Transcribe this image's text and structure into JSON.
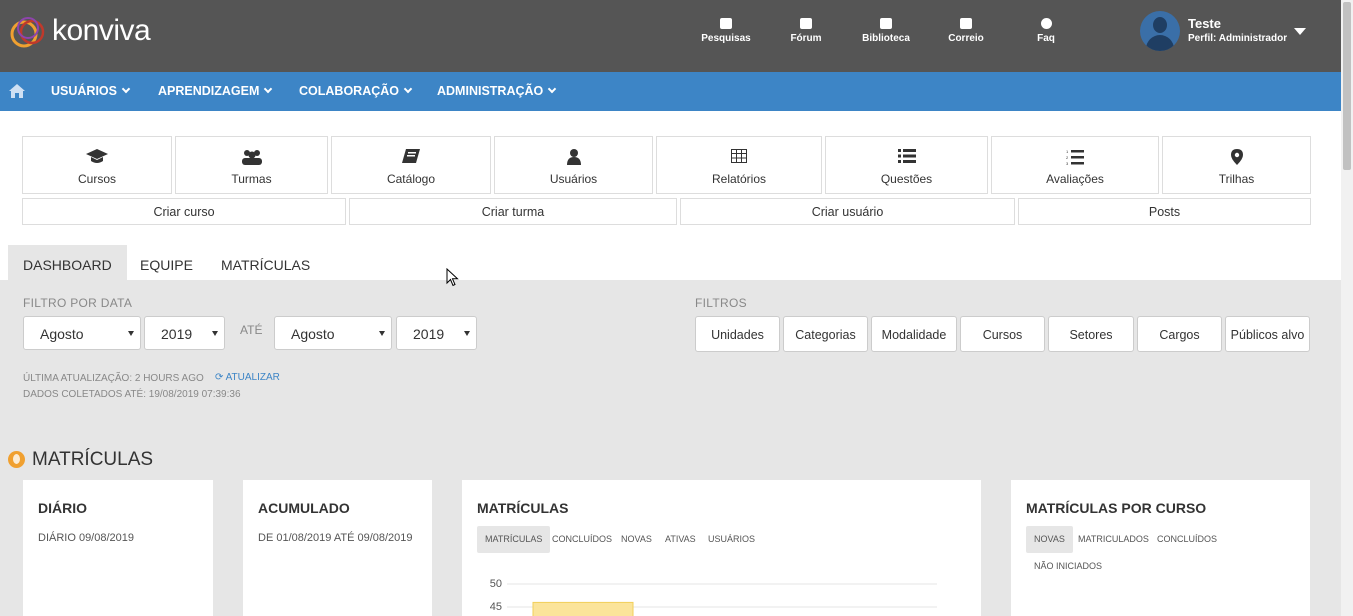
{
  "header": {
    "logo_text": "konviva",
    "nav": [
      {
        "label": "Pesquisas",
        "icon": "search-doc-icon"
      },
      {
        "label": "Fórum",
        "icon": "chat-icon"
      },
      {
        "label": "Biblioteca",
        "icon": "folder-icon"
      },
      {
        "label": "Correio",
        "icon": "envelope-icon"
      },
      {
        "label": "Faq",
        "icon": "question-icon"
      }
    ],
    "user": {
      "name": "Teste",
      "profile": "Perfil: Administrador"
    }
  },
  "mainnav": {
    "items": [
      "USUÁRIOS",
      "APRENDIZAGEM",
      "COLABORAÇÃO",
      "ADMINISTRAÇÃO"
    ]
  },
  "shortcuts": [
    {
      "label": "Cursos",
      "icon": "graduation-cap-icon",
      "glyph": "🎓"
    },
    {
      "label": "Turmas",
      "icon": "users-icon",
      "glyph": "👥"
    },
    {
      "label": "Catálogo",
      "icon": "book-icon",
      "glyph": "📘"
    },
    {
      "label": "Usuários",
      "icon": "user-icon",
      "glyph": "👤"
    },
    {
      "label": "Relatórios",
      "icon": "table-icon",
      "glyph": "▦"
    },
    {
      "label": "Questões",
      "icon": "list-icon",
      "glyph": "☰"
    },
    {
      "label": "Avaliações",
      "icon": "ordered-list-icon",
      "glyph": "☷"
    },
    {
      "label": "Trilhas",
      "icon": "map-marker-icon",
      "glyph": "📍"
    }
  ],
  "quick_actions": [
    "Criar curso",
    "Criar turma",
    "Criar usuário",
    "Posts"
  ],
  "tabs": [
    "DASHBOARD",
    "EQUIPE",
    "MATRÍCULAS"
  ],
  "filters": {
    "date_label": "FILTRO POR DATA",
    "from_month": "Agosto",
    "from_year": "2019",
    "until_label": "ATÉ",
    "to_month": "Agosto",
    "to_year": "2019",
    "filters_label": "FILTROS",
    "buttons": [
      "Unidades",
      "Categorias",
      "Modalidade",
      "Cursos",
      "Setores",
      "Cargos",
      "Públicos alvo"
    ]
  },
  "update": {
    "last_update": "ÚLTIMA ATUALIZAÇÃO: 2 HOURS AGO",
    "refresh": "ATUALIZAR",
    "collected": "DADOS COLETADOS ATÉ: 19/08/2019 07:39:36"
  },
  "section": {
    "title": "MATRÍCULAS"
  },
  "cards": {
    "daily": {
      "title": "DIÁRIO",
      "subtitle": "DIÁRIO 09/08/2019"
    },
    "cumulative": {
      "title": "ACUMULADO",
      "subtitle": "DE 01/08/2019 ATÉ 09/08/2019"
    },
    "enrollments": {
      "title": "MATRÍCULAS",
      "pills": [
        "MATRÍCULAS",
        "CONCLUÍDOS",
        "NOVAS",
        "ATIVAS",
        "USUÁRIOS"
      ],
      "y_ticks": [
        "50",
        "45"
      ],
      "bar_value": 46
    },
    "by_course": {
      "title": "MATRÍCULAS POR CURSO",
      "pills": [
        "NOVAS",
        "MATRICULADOS",
        "CONCLUÍDOS",
        "NÃO INICIADOS"
      ]
    }
  },
  "colors": {
    "header": "#555555",
    "nav": "#3d85c6",
    "dash_bg": "#e6e6e6",
    "bar": "#fbe49a"
  }
}
